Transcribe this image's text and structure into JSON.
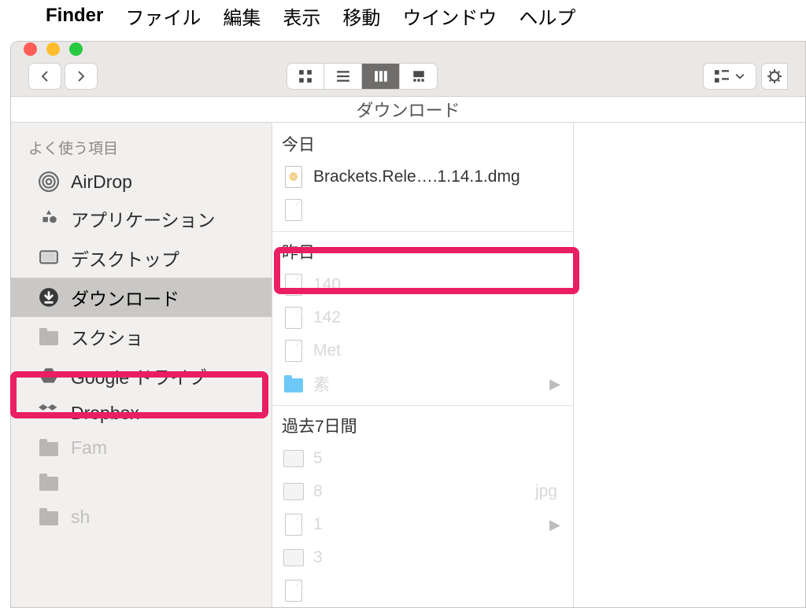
{
  "menubar": {
    "app": "Finder",
    "items": [
      "ファイル",
      "編集",
      "表示",
      "移動",
      "ウインドウ",
      "ヘルプ"
    ]
  },
  "window": {
    "path_title": "ダウンロード"
  },
  "sidebar": {
    "section_header": "よく使う項目",
    "items": [
      {
        "label": "AirDrop",
        "icon": "airdrop"
      },
      {
        "label": "アプリケーション",
        "icon": "apps"
      },
      {
        "label": "デスクトップ",
        "icon": "desktop"
      },
      {
        "label": "ダウンロード",
        "icon": "download",
        "selected": true
      },
      {
        "label": "スクショ",
        "icon": "folder"
      },
      {
        "label": "Google ドライブ",
        "icon": "gdrive"
      },
      {
        "label": "Dropbox",
        "icon": "dropbox"
      },
      {
        "label": "Fam",
        "icon": "folder",
        "faded": true
      },
      {
        "label": "",
        "icon": "folder",
        "faded": true
      },
      {
        "label": "sh",
        "icon": "folder",
        "faded": true
      }
    ]
  },
  "files": {
    "groups": [
      {
        "header": "今日",
        "items": [
          {
            "label": "Brackets.Rele….1.14.1.dmg",
            "icon": "dmg"
          },
          {
            "label": "",
            "icon": "doc",
            "faded": true
          }
        ]
      },
      {
        "header": "昨日",
        "items": [
          {
            "label": "140",
            "icon": "doc",
            "faded": true
          },
          {
            "label": "142",
            "icon": "doc",
            "faded": true
          },
          {
            "label": "Met",
            "icon": "doc",
            "faded": true
          },
          {
            "label": "素",
            "icon": "folder",
            "faded": true,
            "chev": true
          }
        ]
      },
      {
        "header": "過去7日間",
        "items": [
          {
            "label": "5",
            "icon": "pic",
            "faded": true
          },
          {
            "label": "8",
            "icon": "pic",
            "faded": true,
            "suffix": "jpg"
          },
          {
            "label": "1",
            "icon": "doc",
            "faded": true,
            "chev": true
          },
          {
            "label": "3",
            "icon": "pic",
            "faded": true
          },
          {
            "label": "",
            "icon": "doc",
            "faded": true
          }
        ]
      }
    ]
  }
}
